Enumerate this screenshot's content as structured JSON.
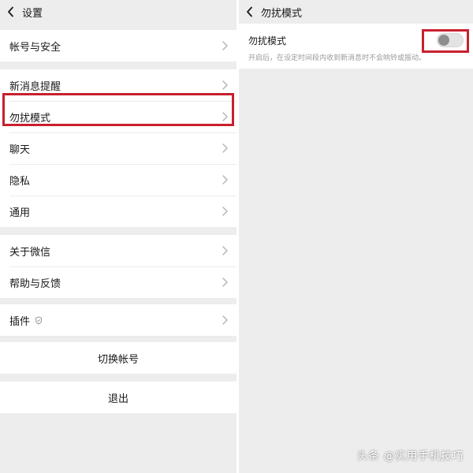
{
  "left": {
    "header_title": "设置",
    "groups": [
      {
        "items": [
          {
            "label": "帐号与安全"
          }
        ]
      },
      {
        "items": [
          {
            "label": "新消息提醒"
          },
          {
            "label": "勿扰模式"
          },
          {
            "label": "聊天"
          },
          {
            "label": "隐私"
          },
          {
            "label": "通用"
          }
        ]
      },
      {
        "items": [
          {
            "label": "关于微信"
          },
          {
            "label": "帮助与反馈"
          }
        ]
      },
      {
        "items": [
          {
            "label": "插件"
          }
        ]
      }
    ],
    "switch_account_label": "切换帐号",
    "logout_label": "退出"
  },
  "right": {
    "header_title": "勿扰模式",
    "dnd": {
      "label": "勿扰模式",
      "enabled": false,
      "description": "开启后，在设定时间段内收到新消息时不会响铃或振动。"
    }
  },
  "watermark": "头条 @实用手机技巧",
  "colors": {
    "highlight": "#c8202e",
    "background": "#ededed",
    "card": "#ffffff"
  },
  "icons": {
    "back": "chevron-left-icon",
    "row": "chevron-right-icon",
    "plugin": "shield-icon"
  }
}
